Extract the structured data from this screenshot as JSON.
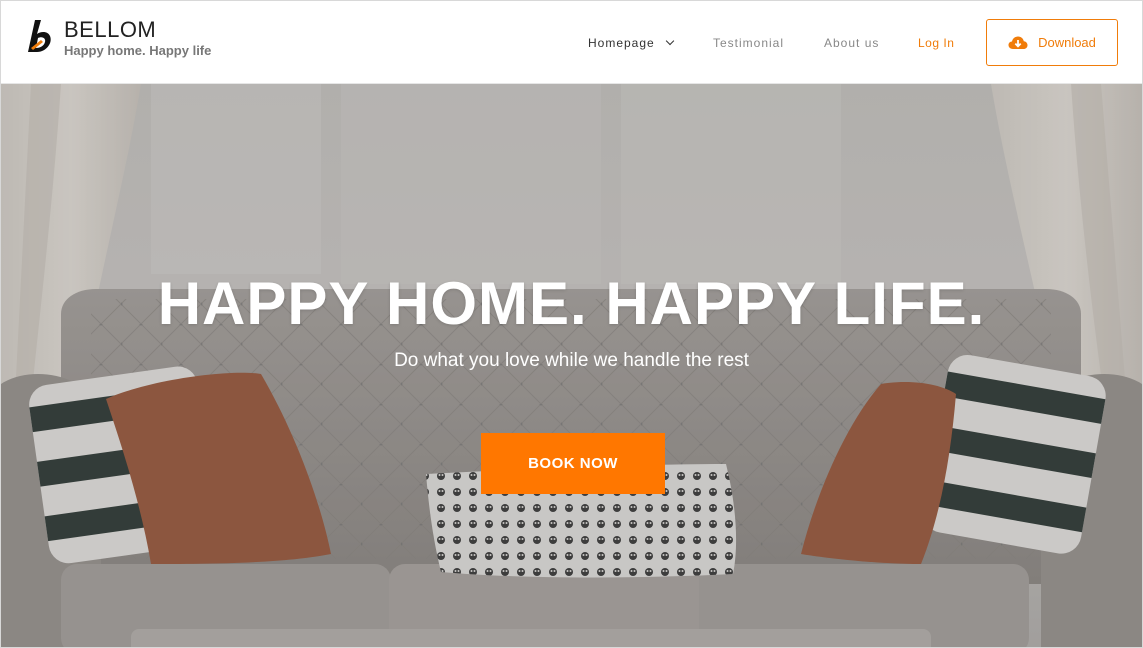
{
  "brand": {
    "name": "BELLOM",
    "tagline": "Happy home. Happy life"
  },
  "nav": {
    "items": [
      {
        "label": "Homepage"
      },
      {
        "label": "Testimonial"
      },
      {
        "label": "About us"
      },
      {
        "label": "Log In"
      }
    ],
    "download_label": "Download"
  },
  "hero": {
    "title": "HAPPY HOME. HAPPY LIFE.",
    "subtitle": "Do what you love while we handle the rest",
    "cta_label": "BOOK NOW"
  },
  "colors": {
    "accent": "#f07c0a",
    "cta": "#ff7700"
  },
  "icons": {
    "logo": "bellom-logo-icon",
    "nav_dropdown": "chevron-down-icon",
    "download": "cloud-download-icon"
  }
}
